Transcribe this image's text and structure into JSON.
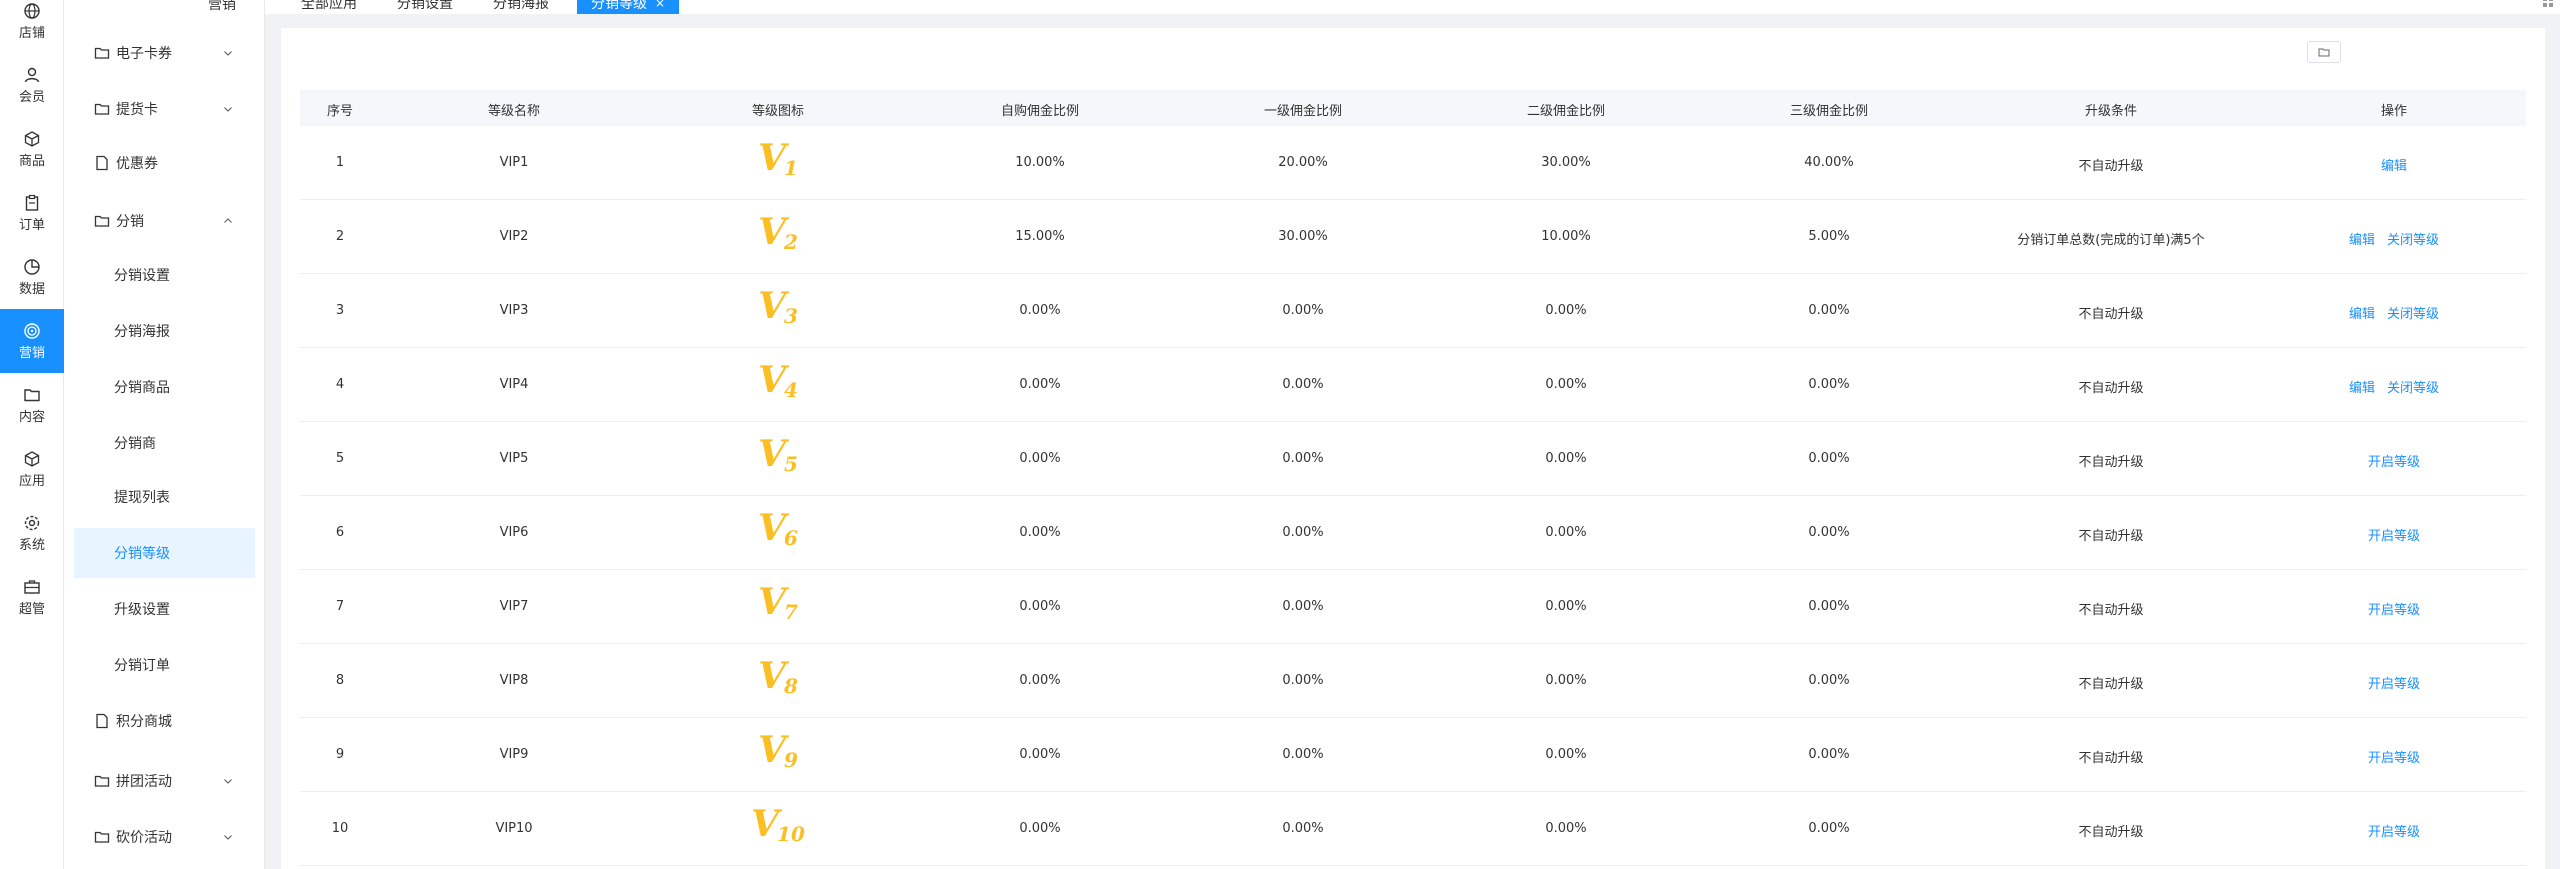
{
  "rail": [
    {
      "label": "店铺",
      "icon": "globe-icon"
    },
    {
      "label": "会员",
      "icon": "user-icon"
    },
    {
      "label": "商品",
      "icon": "cube-icon"
    },
    {
      "label": "订单",
      "icon": "clipboard-icon"
    },
    {
      "label": "数据",
      "icon": "pie-chart-icon"
    },
    {
      "label": "营销",
      "icon": "target-icon",
      "active": true
    },
    {
      "label": "内容",
      "icon": "folder-icon"
    },
    {
      "label": "应用",
      "icon": "box-icon"
    },
    {
      "label": "系统",
      "icon": "gear-icon"
    },
    {
      "label": "超管",
      "icon": "briefcase-icon"
    }
  ],
  "submenu": {
    "top_cut": "营销",
    "items": [
      {
        "label": "电子卡券",
        "icon": "folder",
        "chevron": "down"
      },
      {
        "label": "提货卡",
        "icon": "folder",
        "chevron": "down"
      },
      {
        "label": "优惠券",
        "icon": "doc"
      },
      {
        "label": "分销",
        "icon": "folder",
        "chevron": "up"
      },
      {
        "label": "分销设置",
        "child": true
      },
      {
        "label": "分销海报",
        "child": true
      },
      {
        "label": "分销商品",
        "child": true
      },
      {
        "label": "分销商",
        "child": true
      },
      {
        "label": "提现列表",
        "child": true
      },
      {
        "label": "分销等级",
        "child": true,
        "active": true
      },
      {
        "label": "升级设置",
        "child": true
      },
      {
        "label": "分销订单",
        "child": true
      },
      {
        "label": "积分商城",
        "icon": "doc"
      },
      {
        "label": "拼团活动",
        "icon": "folder",
        "chevron": "down"
      },
      {
        "label": "砍价活动",
        "icon": "folder",
        "chevron": "down"
      }
    ]
  },
  "tabs": [
    {
      "label": "全部应用"
    },
    {
      "label": "分销设置"
    },
    {
      "label": "分销海报"
    },
    {
      "label": "分销等级",
      "active": true,
      "close": "×"
    }
  ],
  "table": {
    "headers": [
      "序号",
      "等级名称",
      "等级图标",
      "自购佣金比例",
      "一级佣金比例",
      "二级佣金比例",
      "三级佣金比例",
      "升级条件",
      "操作"
    ],
    "rows": [
      {
        "no": "1",
        "name": "VIP1",
        "badge": "1",
        "self": "10.00%",
        "l1": "20.00%",
        "l2": "30.00%",
        "l3": "40.00%",
        "cond": "不自动升级",
        "actions": [
          "编辑"
        ]
      },
      {
        "no": "2",
        "name": "VIP2",
        "badge": "2",
        "self": "15.00%",
        "l1": "30.00%",
        "l2": "10.00%",
        "l3": "5.00%",
        "cond": "分销订单总数(完成的订单)满5个",
        "actions": [
          "编辑",
          "关闭等级"
        ]
      },
      {
        "no": "3",
        "name": "VIP3",
        "badge": "3",
        "self": "0.00%",
        "l1": "0.00%",
        "l2": "0.00%",
        "l3": "0.00%",
        "cond": "不自动升级",
        "actions": [
          "编辑",
          "关闭等级"
        ]
      },
      {
        "no": "4",
        "name": "VIP4",
        "badge": "4",
        "self": "0.00%",
        "l1": "0.00%",
        "l2": "0.00%",
        "l3": "0.00%",
        "cond": "不自动升级",
        "actions": [
          "编辑",
          "关闭等级"
        ]
      },
      {
        "no": "5",
        "name": "VIP5",
        "badge": "5",
        "self": "0.00%",
        "l1": "0.00%",
        "l2": "0.00%",
        "l3": "0.00%",
        "cond": "不自动升级",
        "actions": [
          "开启等级"
        ]
      },
      {
        "no": "6",
        "name": "VIP6",
        "badge": "6",
        "self": "0.00%",
        "l1": "0.00%",
        "l2": "0.00%",
        "l3": "0.00%",
        "cond": "不自动升级",
        "actions": [
          "开启等级"
        ]
      },
      {
        "no": "7",
        "name": "VIP7",
        "badge": "7",
        "self": "0.00%",
        "l1": "0.00%",
        "l2": "0.00%",
        "l3": "0.00%",
        "cond": "不自动升级",
        "actions": [
          "开启等级"
        ]
      },
      {
        "no": "8",
        "name": "VIP8",
        "badge": "8",
        "self": "0.00%",
        "l1": "0.00%",
        "l2": "0.00%",
        "l3": "0.00%",
        "cond": "不自动升级",
        "actions": [
          "开启等级"
        ]
      },
      {
        "no": "9",
        "name": "VIP9",
        "badge": "9",
        "self": "0.00%",
        "l1": "0.00%",
        "l2": "0.00%",
        "l3": "0.00%",
        "cond": "不自动升级",
        "actions": [
          "开启等级"
        ]
      },
      {
        "no": "10",
        "name": "VIP10",
        "badge": "10",
        "self": "0.00%",
        "l1": "0.00%",
        "l2": "0.00%",
        "l3": "0.00%",
        "cond": "不自动升级",
        "actions": [
          "开启等级"
        ]
      }
    ]
  },
  "colors": {
    "accent": "#1890ff",
    "badge": "#fbbf24",
    "active_bg": "#e8f4ff"
  }
}
